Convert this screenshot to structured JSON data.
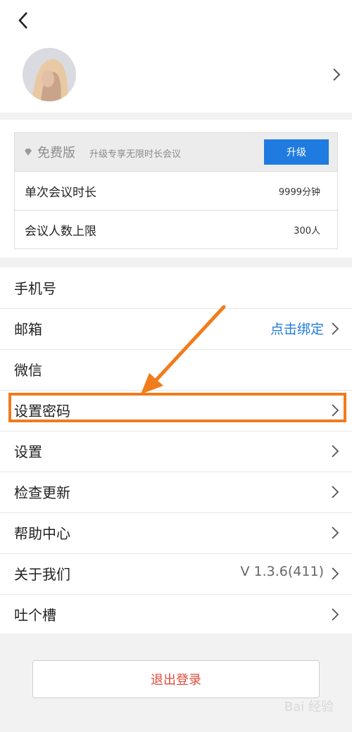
{
  "plan": {
    "name": "免费版",
    "subtitle": "升级专享无限时长会议",
    "upgrade_label": "升级",
    "rows": [
      {
        "label": "单次会议时长",
        "value": "9999分钟"
      },
      {
        "label": "会议人数上限",
        "value": "300人"
      }
    ]
  },
  "menu": [
    {
      "label": "手机号",
      "value": ""
    },
    {
      "label": "邮箱",
      "value": "点击绑定"
    },
    {
      "label": "微信",
      "value": ""
    },
    {
      "label": "设置密码",
      "value": ""
    },
    {
      "label": "设置",
      "value": ""
    },
    {
      "label": "检查更新",
      "value": ""
    },
    {
      "label": "帮助中心",
      "value": ""
    },
    {
      "label": "关于我们",
      "value": "V 1.3.6(411)"
    },
    {
      "label": "吐个槽",
      "value": ""
    }
  ],
  "logout_label": "退出登录",
  "watermark": "Bai 经验",
  "colors": {
    "accent": "#1f7be0",
    "highlight": "#f07c1c",
    "danger": "#e24a3b"
  }
}
